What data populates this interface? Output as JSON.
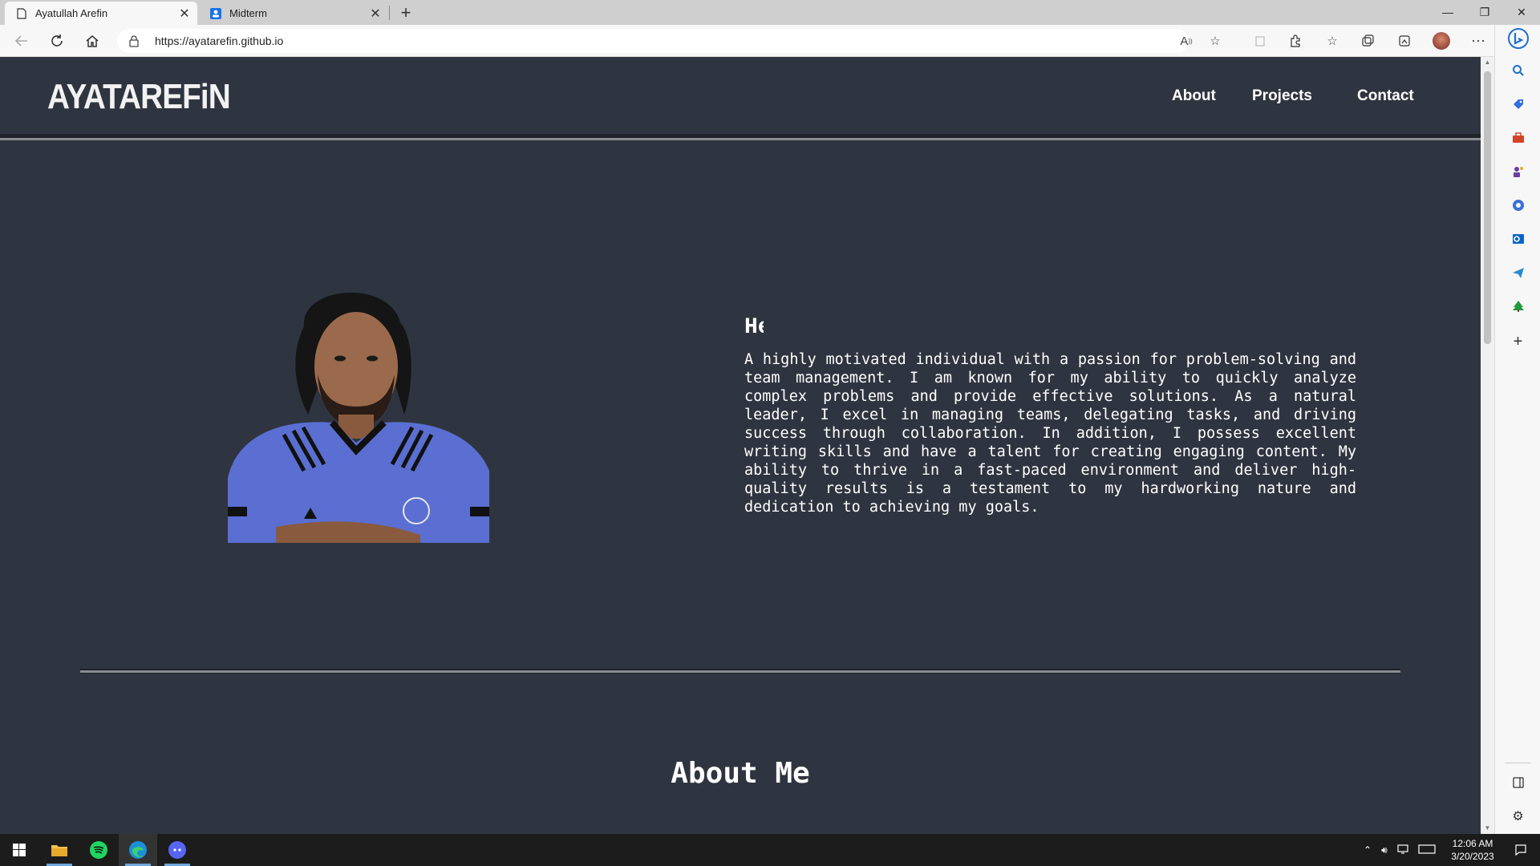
{
  "browser": {
    "tabs": [
      {
        "title": "Ayatullah Arefin",
        "active": true
      },
      {
        "title": "Midterm",
        "active": false
      }
    ],
    "url": "https://ayatarefin.github.io",
    "window_controls": {
      "minimize": "—",
      "restore": "❐",
      "close": "✕"
    }
  },
  "site": {
    "logo": "AYATAREFiN",
    "nav": [
      "About",
      "Projects",
      "Contact"
    ],
    "hero": {
      "heading": "He",
      "paragraph": "A highly motivated individual with a passion for problem-solving and team management. I am known for my ability to quickly analyze complex problems and provide effective solutions. As a natural leader, I excel in managing teams, delegating tasks, and driving success through collaboration. In addition, I possess excellent writing skills and have a talent for creating engaging content. My ability to thrive in a fast-paced environment and deliver high-quality results is a testament to my hardworking nature and dedication to achieving my goals."
    },
    "about_title": "About Me"
  },
  "taskbar": {
    "time": "12:06 AM",
    "date": "3/20/2023"
  },
  "colors": {
    "page_bg": "#2f3540",
    "accent_rule": "#8a8d92",
    "text": "#ffffff"
  }
}
